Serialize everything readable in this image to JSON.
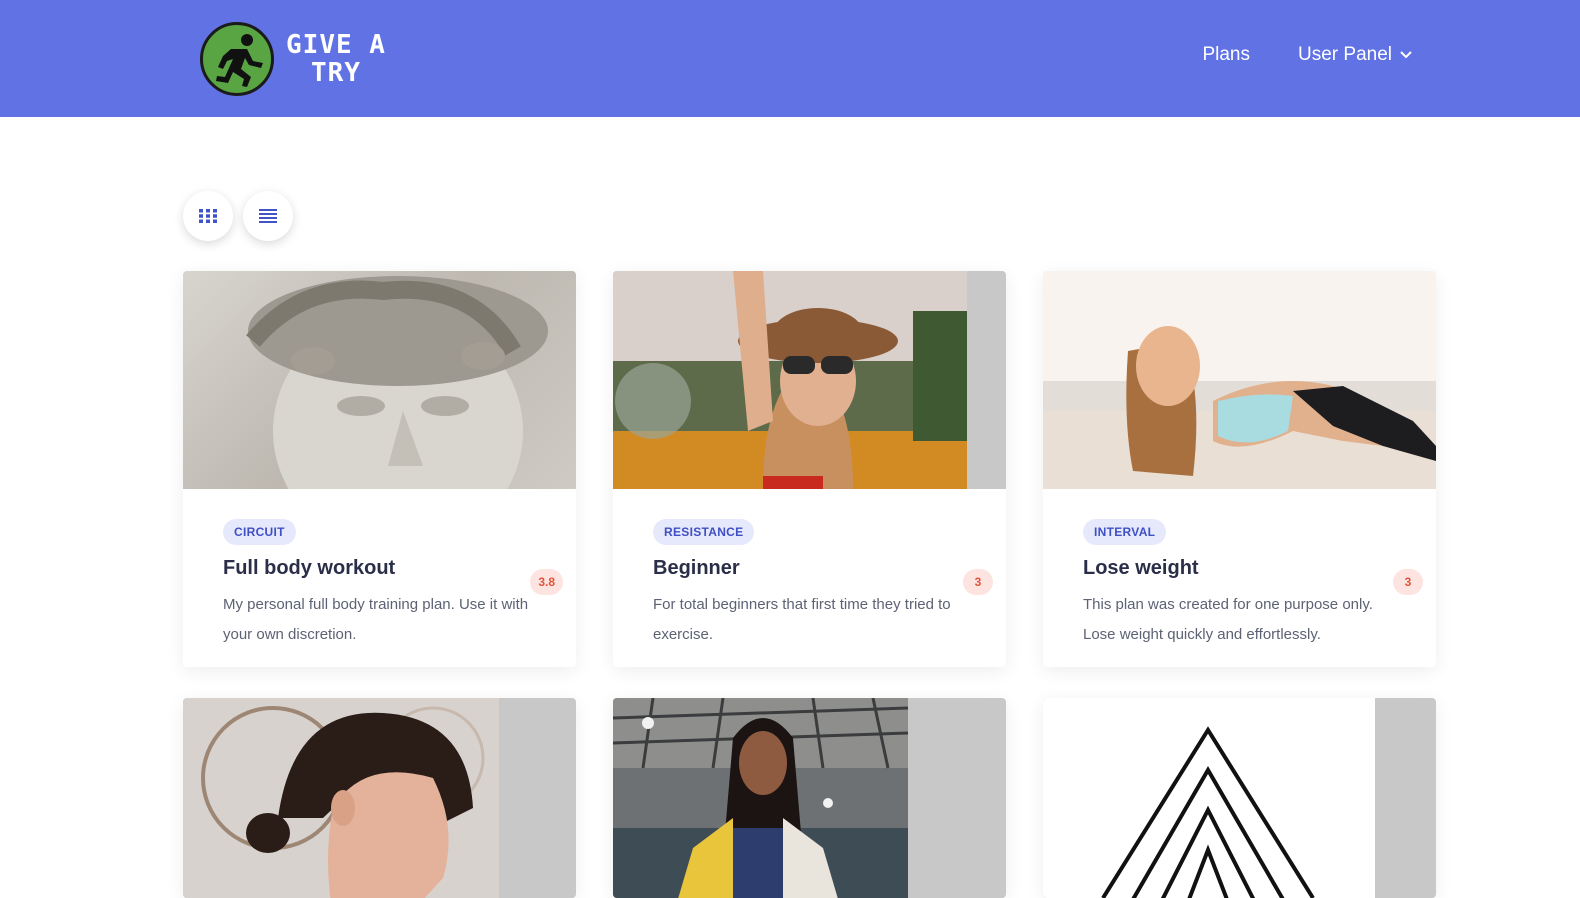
{
  "brand": {
    "name": "GIVE A TRY",
    "line1": "GIVE A",
    "line2": "TRY"
  },
  "nav": {
    "plans": "Plans",
    "user_panel": "User Panel"
  },
  "view_toggle": {
    "grid_icon": "grid-icon",
    "list_icon": "list-icon"
  },
  "colors": {
    "navbar": "#6173e4",
    "tag_bg": "#e6e9fb",
    "tag_text": "#3f4fc4",
    "rating_bg": "#fde4e0",
    "rating_text": "#e2533b",
    "logo_green": "#5aa543"
  },
  "plans": [
    {
      "tag": "CIRCUIT",
      "title": "Full body workout",
      "description": "My personal full body training plan. Use it with your own discretion.",
      "rating": "3.8",
      "image": "statue-photo"
    },
    {
      "tag": "RESISTANCE",
      "title": "Beginner",
      "description": "For total beginners that first time they tried to exercise.",
      "rating": "3",
      "image": "woman-hat-sunflowers-photo"
    },
    {
      "tag": "INTERVAL",
      "title": "Lose weight",
      "description": "This plan was created for one purpose only. Lose weight quickly and effortlessly.",
      "rating": "3",
      "image": "woman-plank-beach-photo"
    },
    {
      "image": "woman-profile-photo"
    },
    {
      "image": "woman-gym-photo"
    },
    {
      "image": "triangle-logo-image"
    }
  ]
}
